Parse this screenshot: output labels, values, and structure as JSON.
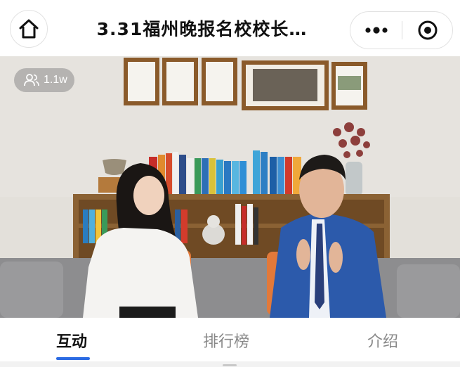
{
  "header": {
    "title": "3.31福州晚报名校校长…",
    "home_icon": "home-icon",
    "more_icon": "more-dots-icon",
    "close_icon": "record-close-icon"
  },
  "live": {
    "viewer_count": "1.1w",
    "viewer_icon": "viewers-icon"
  },
  "tabs": {
    "items": [
      {
        "label": "互动",
        "active": true
      },
      {
        "label": "排行榜",
        "active": false
      },
      {
        "label": "介绍",
        "active": false
      }
    ],
    "accent_color": "#2b6be3"
  }
}
